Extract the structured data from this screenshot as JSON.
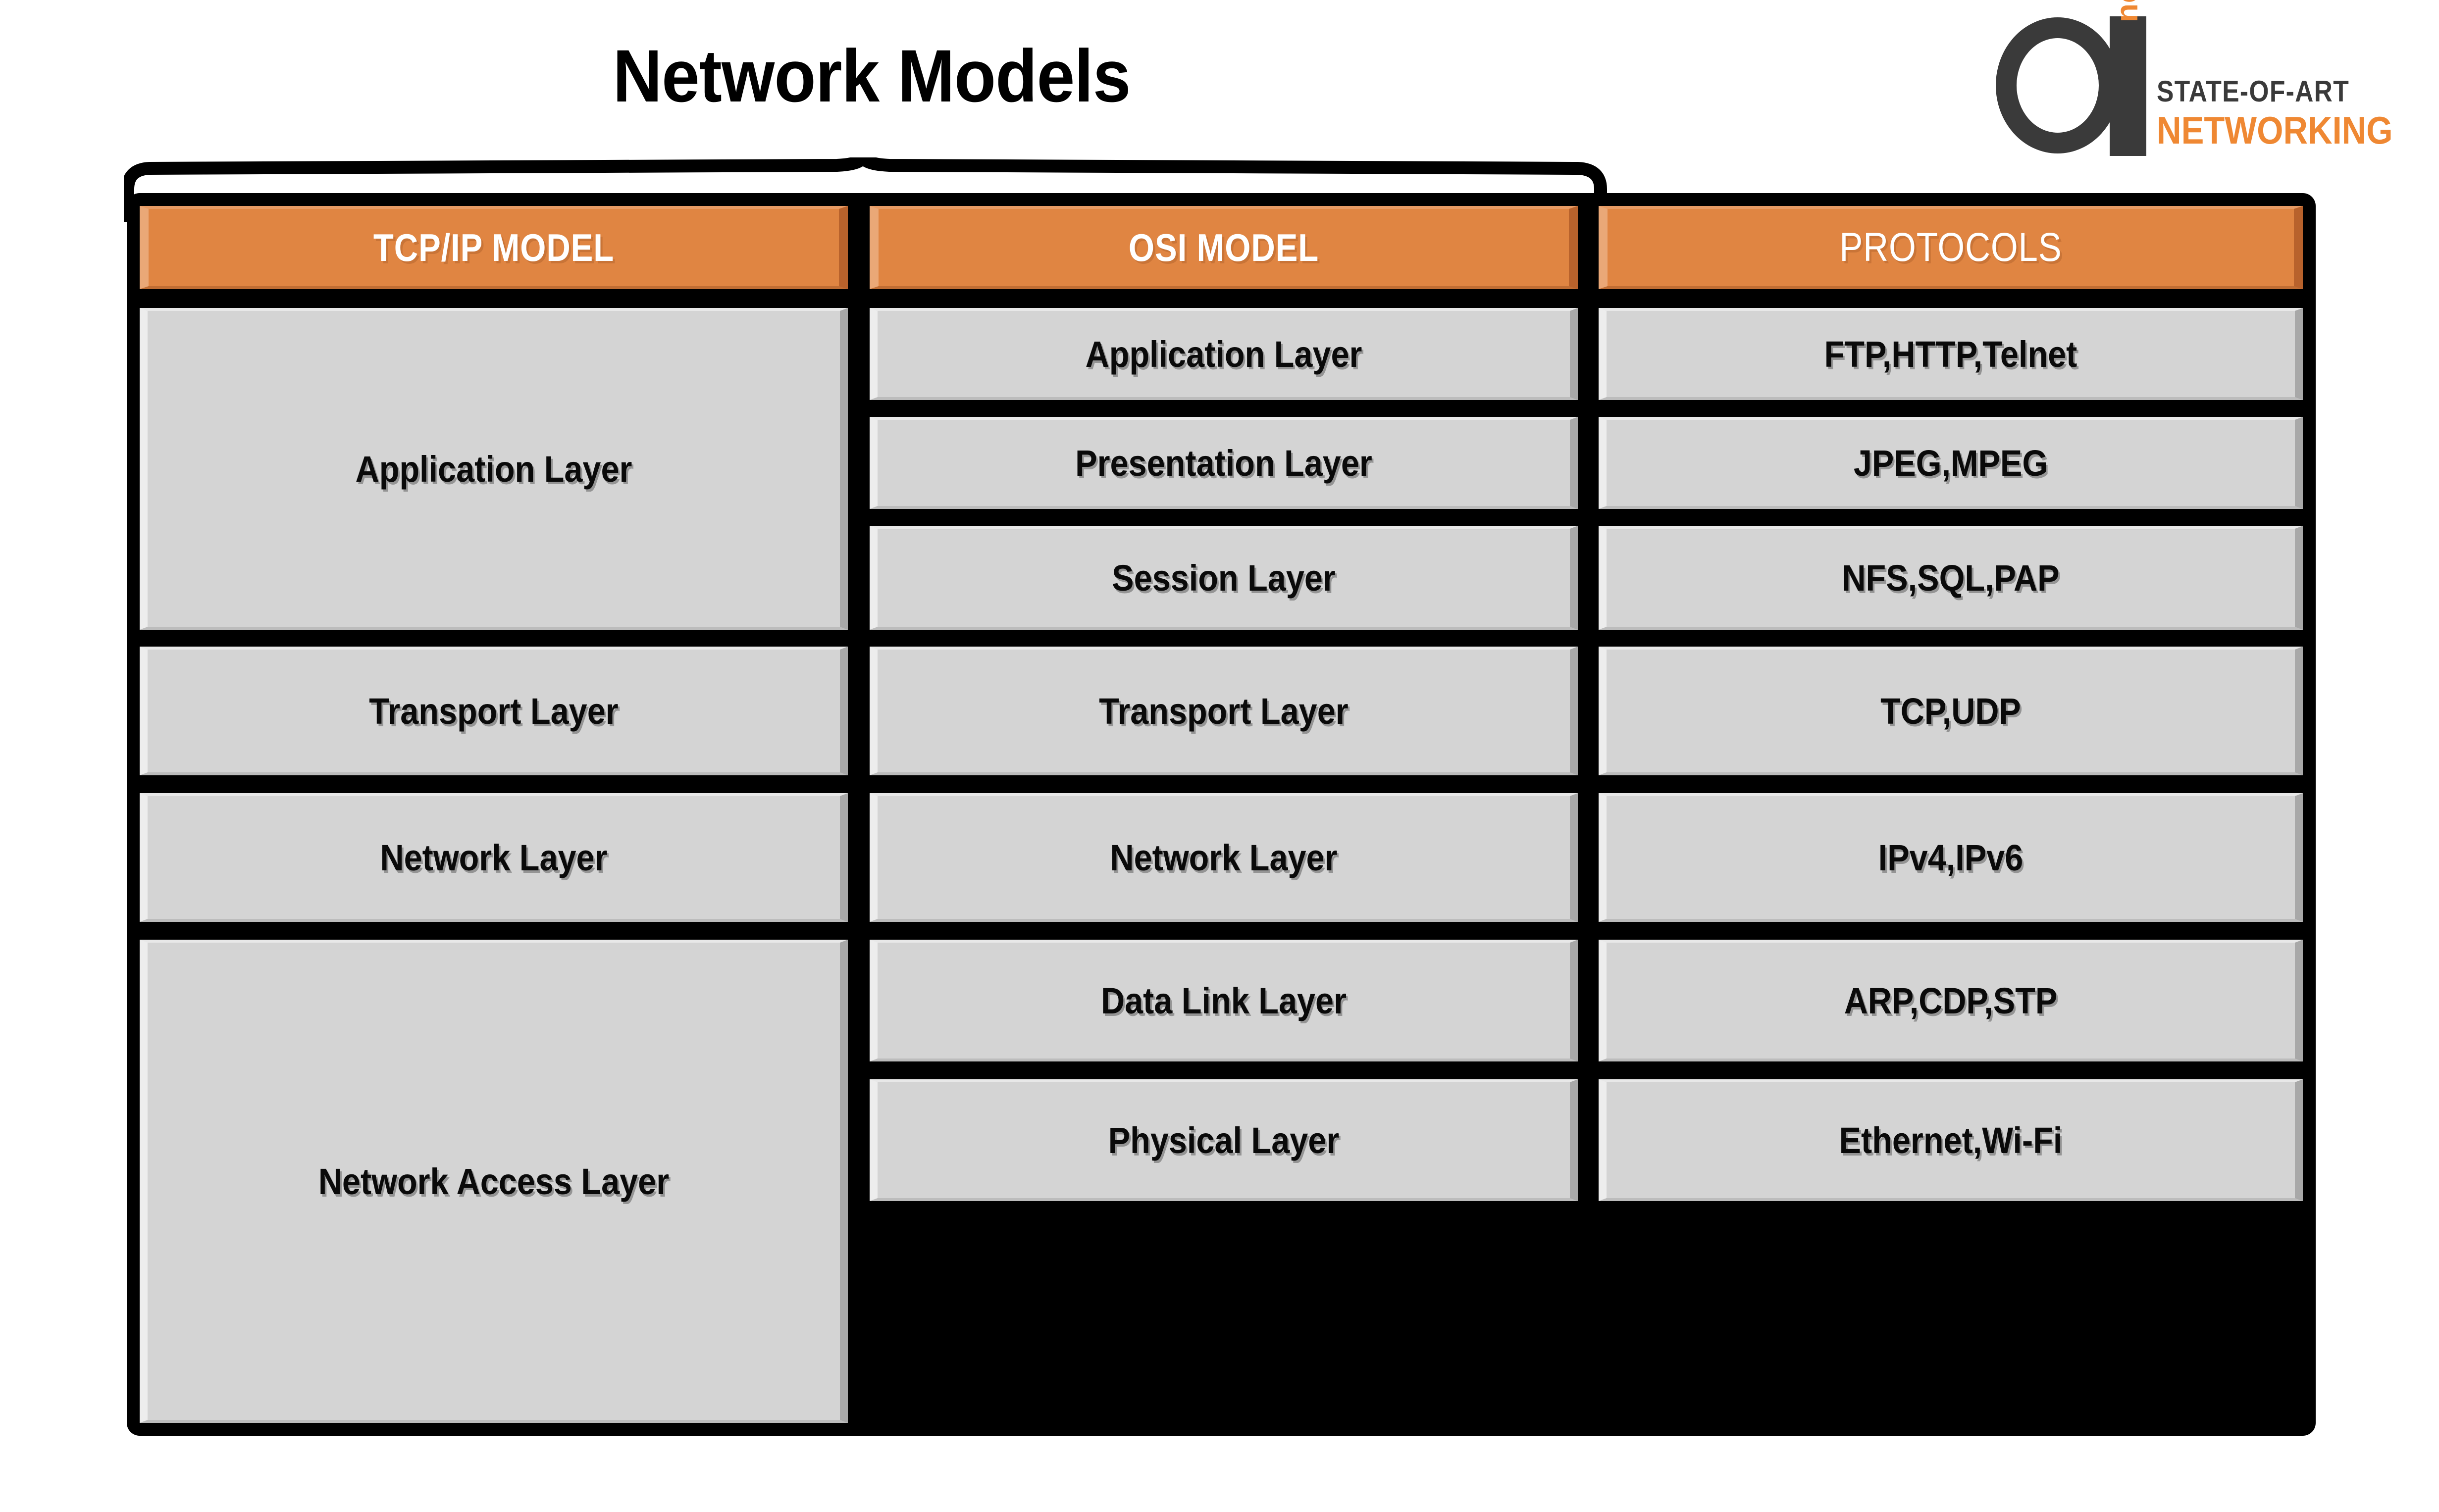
{
  "title": "Network Models",
  "logo": {
    "mark_letter": "O",
    "mark_word": "net",
    "line1": "STATE-OF-ART",
    "line2": "NETWORKING",
    "colors": {
      "orange": "#ef8833",
      "dark": "#3a3a3a"
    }
  },
  "colors": {
    "header_orange": "#e08542",
    "cell_gray": "#d4d4d4",
    "frame_black": "#000000",
    "header_text": "#ffffff",
    "cell_text": "#0a0a0a"
  },
  "table": {
    "headers": [
      {
        "label": "TCP/IP MODEL",
        "bold": true
      },
      {
        "label": "OSI MODEL",
        "bold": true
      },
      {
        "label": "PROTOCOLS",
        "bold": false
      }
    ],
    "tcpip_layers": [
      {
        "label": "Application Layer",
        "spans_osi_rows": 3
      },
      {
        "label": "Transport Layer",
        "spans_osi_rows": 1
      },
      {
        "label": "Network Layer",
        "spans_osi_rows": 1
      },
      {
        "label": "Network Access Layer",
        "spans_osi_rows": 2
      }
    ],
    "osi_layers": [
      "Application Layer",
      "Presentation Layer",
      "Session Layer",
      "Transport Layer",
      "Network Layer",
      "Data Link Layer",
      "Physical Layer"
    ],
    "protocols": [
      "FTP,HTTP,Telnet",
      "JPEG,MPEG",
      "NFS,SQL,PAP",
      "TCP,UDP",
      "IPv4,IPv6",
      "ARP,CDP,STP",
      "Ethernet,Wi-Fi"
    ]
  },
  "brace": {
    "label": "brace-over-tcpip-and-osi"
  }
}
